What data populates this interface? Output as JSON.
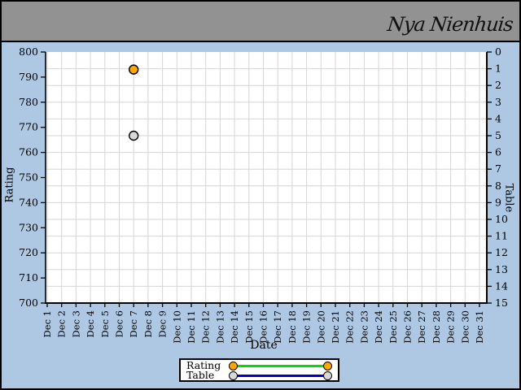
{
  "header": {
    "player_name": "Nya Nienhuis"
  },
  "chart_data": {
    "type": "scatter",
    "title": "",
    "xlabel": "Date",
    "x_categories": [
      "Dec 1",
      "Dec 2",
      "Dec 3",
      "Dec 4",
      "Dec 5",
      "Dec 6",
      "Dec 7",
      "Dec 8",
      "Dec 9",
      "Dec 10",
      "Dec 11",
      "Dec 12",
      "Dec 13",
      "Dec 14",
      "Dec 15",
      "Dec 16",
      "Dec 17",
      "Dec 18",
      "Dec 19",
      "Dec 20",
      "Dec 21",
      "Dec 22",
      "Dec 23",
      "Dec 24",
      "Dec 25",
      "Dec 26",
      "Dec 27",
      "Dec 28",
      "Dec 29",
      "Dec 30",
      "Dec 31"
    ],
    "left_axis": {
      "label": "Rating",
      "min": 700,
      "max": 800,
      "step": 10,
      "direction": "max-at-top"
    },
    "right_axis": {
      "label": "Table",
      "min": 0,
      "max": 15,
      "step": 1,
      "direction": "min-at-top"
    },
    "grid": true,
    "legend_position": "bottom",
    "series": [
      {
        "name": "Rating",
        "axis": "left",
        "marker_color": "#ffa500",
        "line_color": "#00dd00",
        "points": [
          {
            "x": "Dec 7",
            "y": 793
          }
        ]
      },
      {
        "name": "Table",
        "axis": "right",
        "marker_color": "#d8d8d8",
        "line_color": "#0000cc",
        "points": [
          {
            "x": "Dec 7",
            "y": 5
          }
        ]
      }
    ]
  },
  "colors": {
    "header_bg": "#929292",
    "chart_bg": "#aec8e4",
    "plot_bg": "#ffffff",
    "gridline": "#d6d6d6",
    "axis": "#000000",
    "text": "#000000"
  }
}
